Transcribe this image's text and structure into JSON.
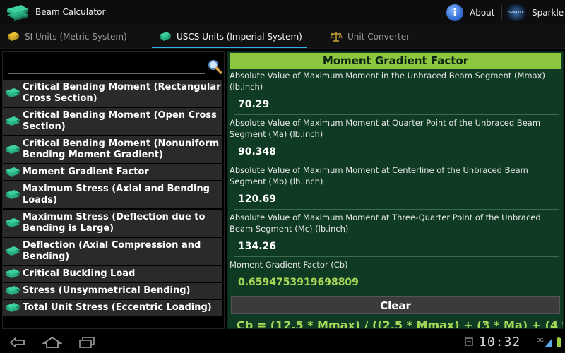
{
  "app": {
    "title": "Beam Calculator",
    "about_label": "About",
    "about_icon_glyph": "i",
    "sparkle_label": "Sparkle",
    "sparkle_icon_text": "SPARKLE"
  },
  "tabs": [
    {
      "label": "SI Units (Metric System)",
      "active": false
    },
    {
      "label": "USCS Units (Imperial System)",
      "active": true
    },
    {
      "label": "Unit Converter",
      "active": false
    }
  ],
  "search": {
    "value": "",
    "placeholder": ""
  },
  "list_items": [
    "Critical Bending Moment (Rectangular Cross Section)",
    "Critical Bending Moment (Open Cross Section)",
    "Critical Bending Moment (Nonuniform Bending Moment Gradient)",
    "Moment Gradient Factor",
    "Maximum Stress (Axial and Bending Loads)",
    "Maximum Stress (Deflection due to Bending is Large)",
    "Deflection (Axial Compression and Bending)",
    "Critical Buckling Load",
    "Stress (Unsymmetrical Bending)",
    "Total Unit Stress (Eccentric Loading)"
  ],
  "panel": {
    "title": "Moment Gradient Factor",
    "fields": [
      {
        "label": "Absolute Value of Maximum Moment in the Unbraced Beam Segment (Mmax) (lb.inch)",
        "value": "70.29"
      },
      {
        "label": "Absolute Value of Maximum Moment at Quarter Point of the Unbraced Beam Segment (Ma) (lb.inch)",
        "value": "90.348"
      },
      {
        "label": "Absolute Value of Maximum Moment at Centerline of the Unbraced Beam Segment (Mb) (lb.inch)",
        "value": "120.69"
      },
      {
        "label": "Absolute Value of Maximum Moment at Three-Quarter Point of the Unbraced Beam Segment (Mc) (lb.inch)",
        "value": "134.26"
      }
    ],
    "result_label": "Moment Gradient Factor (Cb)",
    "result_value": "0.6594753919698809",
    "clear_label": "Clear",
    "formula": "Cb = (12.5 * Mmax) / ((2.5 * Mmax) + (3 * Ma) + (4 *"
  },
  "system": {
    "clock": "10:32",
    "signal": "3G"
  },
  "colors": {
    "accent": "#2fb4e8",
    "header_green": "#8dc63f",
    "panel_green": "#0f3b24",
    "result_green": "#a8d858"
  },
  "icons": {
    "app": "beam-icon",
    "search": "search-icon",
    "about": "info-icon",
    "back": "back-icon",
    "home": "home-icon",
    "recent": "recent-apps-icon"
  }
}
